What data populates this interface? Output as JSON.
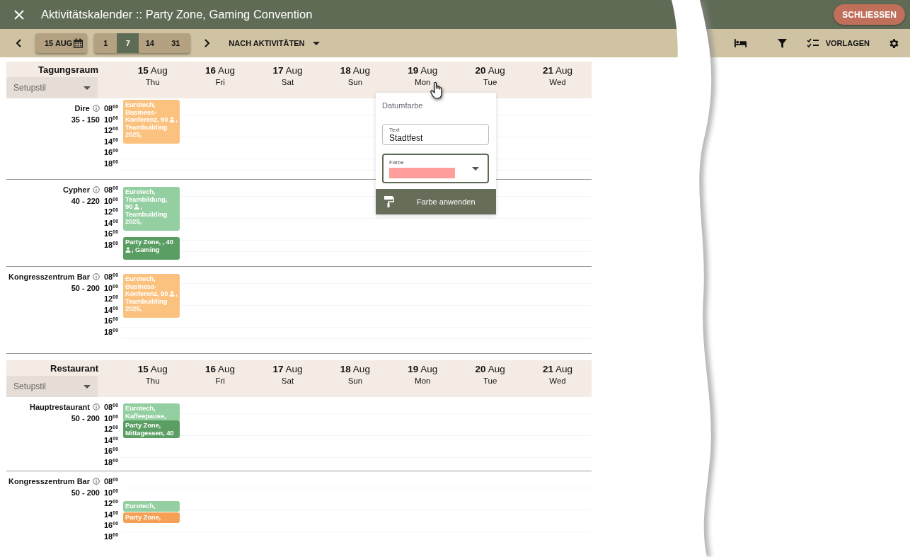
{
  "window": {
    "title": "Aktivitätskalender :: Party Zone, Gaming Convention",
    "close_label": "SCHLIESSEN"
  },
  "toolbar": {
    "date": "15 AUG",
    "ranges": [
      {
        "label": "1",
        "selected": false
      },
      {
        "label": "7",
        "selected": true
      },
      {
        "label": "14",
        "selected": false
      },
      {
        "label": "31",
        "selected": false
      }
    ],
    "view": "NACH AKTIVITÄTEN",
    "templates": "VORLAGEN"
  },
  "sections": [
    {
      "title": "Tagungsraum",
      "setup": {
        "placeholder": "Setupstil"
      },
      "days": [
        {
          "date": "**15** Aug",
          "weekday": "Thu"
        },
        {
          "date": "**16** Aug",
          "weekday": "Fri"
        },
        {
          "date": "**17** Aug",
          "weekday": "Sat"
        },
        {
          "date": "**18** Aug",
          "weekday": "Sun"
        },
        {
          "date": "**19** Aug",
          "weekday": "Mon"
        },
        {
          "date": "**20** Aug",
          "weekday": "Tue"
        },
        {
          "date": "**21** Aug",
          "weekday": "Wed"
        }
      ],
      "rooms": [
        {
          "name": "Dire",
          "capacity": "35 - 150",
          "hours": [
            "08$^{00}$",
            "10$^{00}$",
            "12$^{00}$",
            "14$^{00}$",
            "16$^{00}$",
            "18$^{00}$"
          ],
          "events": [
            {
              "color": "#fbc27f",
              "lines": [
                [
                  {
                    "kind": "text",
                    "text": "Eurotech,"
                  }
                ],
                [
                  {
                    "kind": "text",
                    "text": "Business-"
                  }
                ],
                [
                  {
                    "kind": "text",
                    "text": "Konferenz, 90"
                  },
                  {
                    "kind": "person"
                  },
                  {
                    "kind": "text",
                    "text": ","
                  }
                ],
                [
                  {
                    "kind": "text",
                    "text": "Teambuilding"
                  }
                ],
                [
                  {
                    "kind": "text",
                    "text": "2025,"
                  }
                ]
              ]
            }
          ]
        },
        {
          "name": "Cypher",
          "capacity": "40 - 220",
          "hours": [
            "08$^{00}$",
            "10$^{00}$",
            "12$^{00}$",
            "14$^{00}$",
            "16$^{00}$",
            "18$^{00}$"
          ],
          "events": [
            {
              "color": "#93cfa0",
              "lines": [
                [
                  {
                    "kind": "text",
                    "text": "Eurotech,"
                  }
                ],
                [
                  {
                    "kind": "text",
                    "text": "Teambildung,"
                  }
                ],
                [
                  {
                    "kind": "text",
                    "text": "90"
                  },
                  {
                    "kind": "person"
                  },
                  {
                    "kind": "text",
                    "text": ","
                  }
                ],
                [
                  {
                    "kind": "text",
                    "text": "Teambuilding"
                  }
                ],
                [
                  {
                    "kind": "text",
                    "text": "2025,"
                  }
                ]
              ]
            },
            {
              "color": "#5a9e63",
              "lines": [
                [
                  {
                    "kind": "text",
                    "text": "Party Zone, , 40"
                  }
                ],
                [
                  {
                    "kind": "person"
                  },
                  {
                    "kind": "text",
                    "text": ", Gaming"
                  }
                ]
              ]
            }
          ]
        },
        {
          "name": "Kongresszentrum Bar",
          "capacity": "50 - 200",
          "hours": [
            "08$^{00}$",
            "10$^{00}$",
            "12$^{00}$",
            "14$^{00}$",
            "16$^{00}$",
            "18$^{00}$"
          ],
          "events": [
            {
              "color": "#fbc27f",
              "lines": [
                [
                  {
                    "kind": "text",
                    "text": "Eurotech,"
                  }
                ],
                [
                  {
                    "kind": "text",
                    "text": "Business-"
                  }
                ],
                [
                  {
                    "kind": "text",
                    "text": "Konferenz, 90"
                  },
                  {
                    "kind": "person"
                  },
                  {
                    "kind": "text",
                    "text": ","
                  }
                ],
                [
                  {
                    "kind": "text",
                    "text": "Teambuilding"
                  }
                ],
                [
                  {
                    "kind": "text",
                    "text": "2025,"
                  }
                ]
              ]
            }
          ]
        }
      ]
    },
    {
      "title": "Restaurant",
      "setup": {
        "placeholder": "Setupstil"
      },
      "days": [
        {
          "date": "**15** Aug",
          "weekday": "Thu"
        },
        {
          "date": "**16** Aug",
          "weekday": "Fri"
        },
        {
          "date": "**17** Aug",
          "weekday": "Sat"
        },
        {
          "date": "**18** Aug",
          "weekday": "Sun"
        },
        {
          "date": "**19** Aug",
          "weekday": "Mon"
        },
        {
          "date": "**20** Aug",
          "weekday": "Tue"
        },
        {
          "date": "**21** Aug",
          "weekday": "Wed"
        }
      ],
      "rooms": [
        {
          "name": "Hauptrestaurant",
          "capacity": "50 - 200",
          "hours": [
            "08$^{00}$",
            "10$^{00}$",
            "12$^{00}$",
            "14$^{00}$",
            "16$^{00}$",
            "18$^{00}$"
          ],
          "events": [
            {
              "color": "#93cfa0",
              "lines": [
                [
                  {
                    "kind": "text",
                    "text": "Eurotech,"
                  }
                ],
                [
                  {
                    "kind": "text",
                    "text": "Kaffeepause,"
                  }
                ]
              ]
            },
            {
              "color": "#5a9e63",
              "lines": [
                [
                  {
                    "kind": "text",
                    "text": "Party Zone,"
                  }
                ],
                [
                  {
                    "kind": "text",
                    "text": "Mittagessen, 40"
                  }
                ]
              ]
            }
          ]
        },
        {
          "name": "Kongresszentrum Bar",
          "capacity": "50 - 200",
          "hours": [
            "08$^{00}$",
            "10$^{00}$",
            "12$^{00}$",
            "14$^{00}$",
            "16$^{00}$",
            "18$^{00}$"
          ],
          "events": [
            {
              "color": "#93cfa0",
              "lines": [
                [
                  {
                    "kind": "text",
                    "text": "Eurotech,"
                  }
                ]
              ]
            },
            {
              "color": "#f5a054",
              "lines": [
                [
                  {
                    "kind": "text",
                    "text": "Party Zone,"
                  }
                ]
              ]
            }
          ]
        }
      ]
    }
  ],
  "popup": {
    "title": "Datumfarbe",
    "text_field": {
      "label": "Text",
      "value": "Stadtfest"
    },
    "color_field": {
      "label": "Farbe",
      "color": "#ff9e9b"
    },
    "button": "Farbe anwenden"
  }
}
